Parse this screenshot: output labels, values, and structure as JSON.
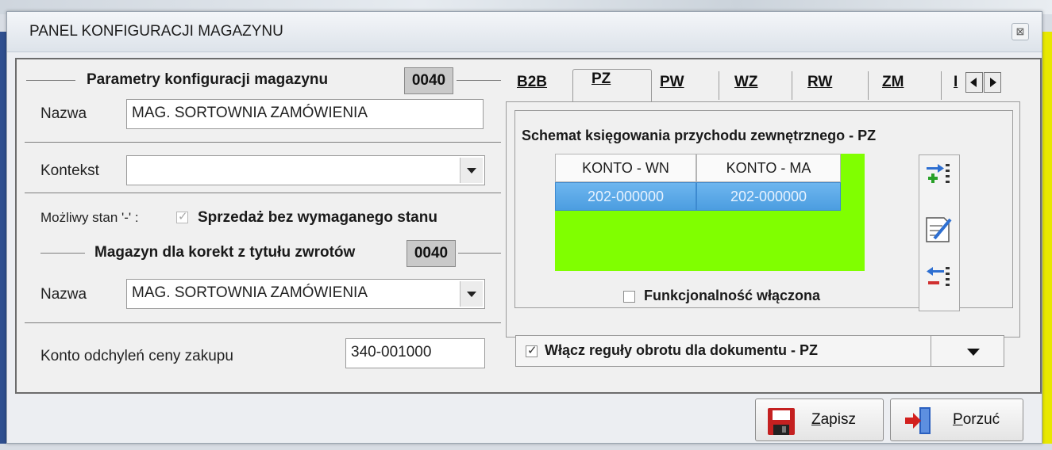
{
  "window": {
    "title": "PANEL KONFIGURACJI MAGAZYNU",
    "close_glyph": "⊠"
  },
  "params": {
    "group_title": "Parametry  konfiguracji  magazynu",
    "code": "0040",
    "name_label": "Nazwa",
    "name_value": "MAG. SORTOWNIA ZAMÓWIENIA",
    "context_label": "Kontekst",
    "context_value": "",
    "negative_stock_label": "Możliwy stan '-' :",
    "negative_stock_checked": true,
    "sale_without_stock_label": "Sprzedaż bez wymaganego stanu"
  },
  "returns": {
    "group_title": "Magazyn dla korekt z tytułu zwrotów",
    "code": "0040",
    "name_label": "Nazwa",
    "name_value": "MAG. SORTOWNIA ZAMÓWIENIA"
  },
  "variance": {
    "label": "Konto odchyleń  ceny  zakupu",
    "value": "340-001000"
  },
  "tabs": [
    {
      "label": "B2B",
      "active": false
    },
    {
      "label": "PZ",
      "active": true
    },
    {
      "label": "PW",
      "active": false
    },
    {
      "label": "WZ",
      "active": false
    },
    {
      "label": "RW",
      "active": false
    },
    {
      "label": "ZM",
      "active": false
    },
    {
      "label": "I",
      "active": false
    }
  ],
  "schema": {
    "title": "Schemat księgowania przychodu zewnętrznego - PZ",
    "columns": [
      "KONTO - WN",
      "KONTO - MA"
    ],
    "rows": [
      [
        "202-000000",
        "202-000000"
      ]
    ],
    "functionality_label": "Funkcjonalność włączona",
    "functionality_checked": false,
    "grid_color": "#80ff00"
  },
  "toolbar_icons": [
    "add-row-icon",
    "edit-icon",
    "remove-row-icon"
  ],
  "rules": {
    "label": "Włącz reguły obrotu dla dokumentu - PZ",
    "checked": true
  },
  "buttons": {
    "save_underlined": "Z",
    "save_rest": "apisz",
    "cancel_underlined": "P",
    "cancel_rest": "orzuć"
  }
}
